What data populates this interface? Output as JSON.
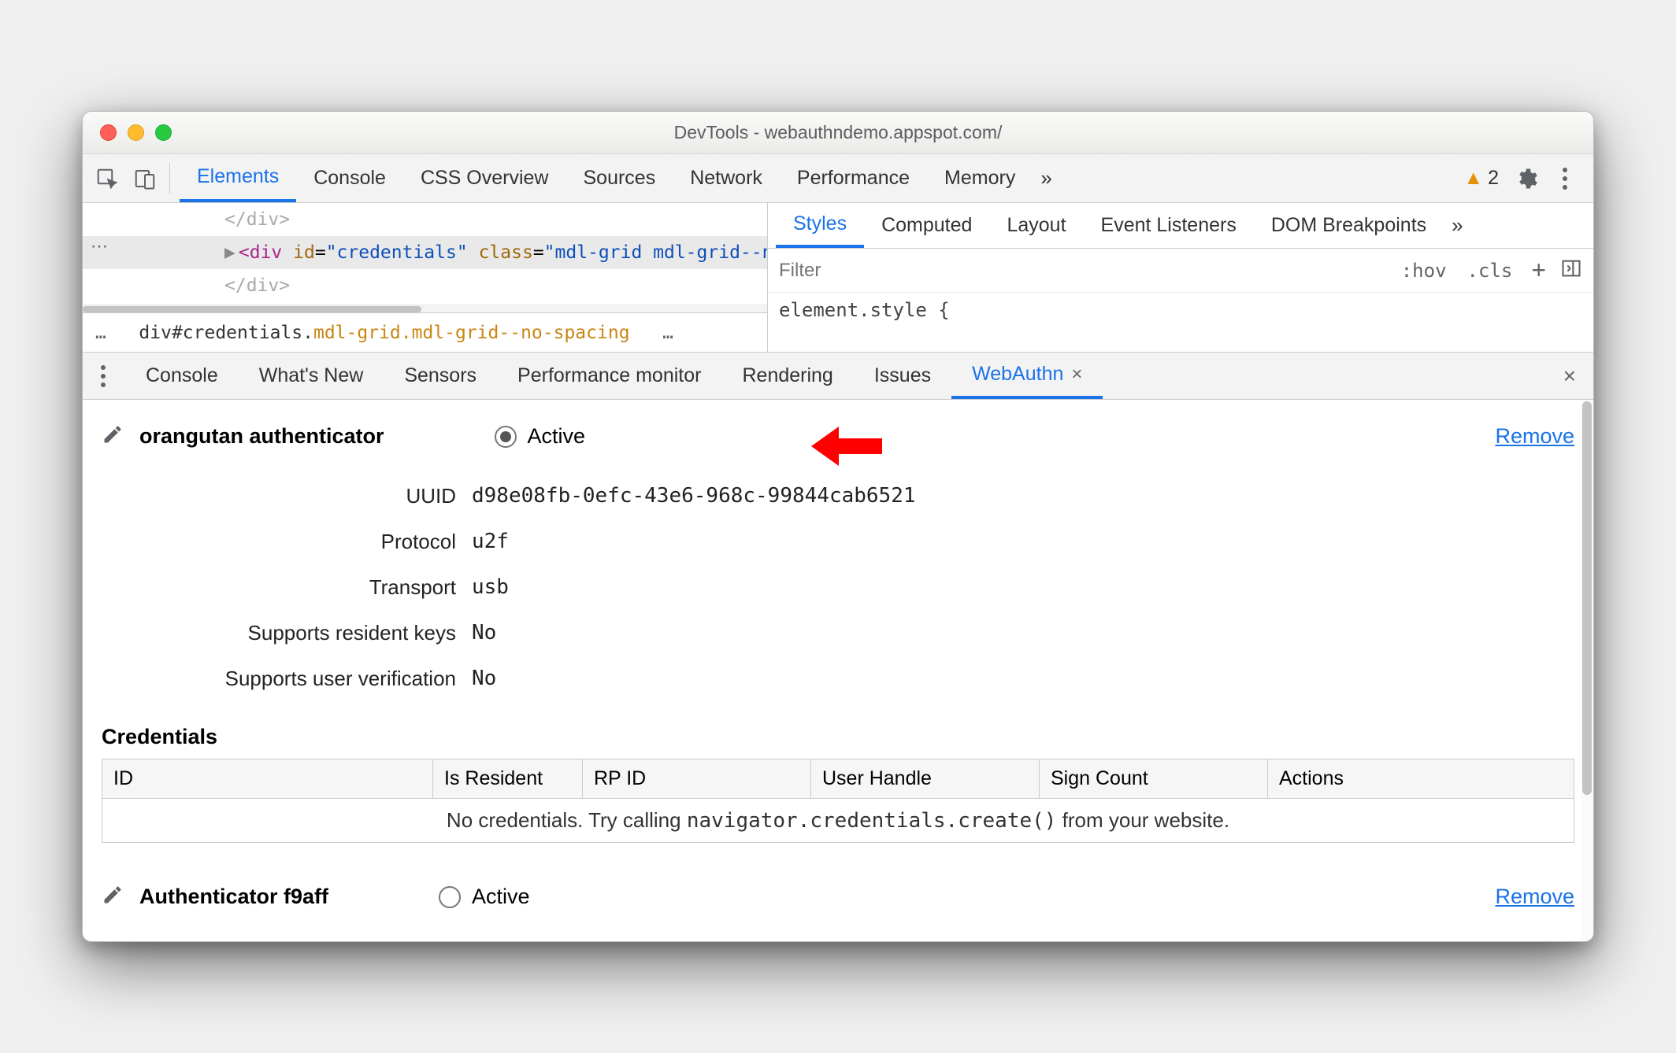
{
  "title": "DevTools - webauthndemo.appspot.com/",
  "main_tabs": [
    "Elements",
    "Console",
    "CSS Overview",
    "Sources",
    "Network",
    "Performance",
    "Memory"
  ],
  "main_active": "Elements",
  "warning_count": "2",
  "elements": {
    "line0": "</div>",
    "line1_open": "<",
    "line1_tag": "div",
    "line1_id_attr": "id",
    "line1_id_val": "\"credentials\"",
    "line1_cls_attr": "class",
    "line1_cls_val": "\"mdl-grid mdl-grid--no-spacing\"",
    "line1_mid": ">…</",
    "line1_close": ">",
    "line2": "</div>",
    "breadcrumb_ellipsis": "…",
    "breadcrumb_a": "div#credentials.",
    "breadcrumb_b": "mdl-grid.mdl-grid--no-spacing",
    "breadcrumb_ellipsis2": "…"
  },
  "styles": {
    "tabs": [
      "Styles",
      "Computed",
      "Layout",
      "Event Listeners",
      "DOM Breakpoints"
    ],
    "active": "Styles",
    "filter_placeholder": "Filter",
    "hov": ":hov",
    "cls": ".cls",
    "rule": "element.style {"
  },
  "drawer": {
    "tabs": [
      "Console",
      "What's New",
      "Sensors",
      "Performance monitor",
      "Rendering",
      "Issues",
      "WebAuthn"
    ],
    "active": "WebAuthn"
  },
  "auth1": {
    "name": "orangutan authenticator",
    "active_label": "Active",
    "remove": "Remove",
    "uuid_label": "UUID",
    "uuid": "d98e08fb-0efc-43e6-968c-99844cab6521",
    "protocol_label": "Protocol",
    "protocol": "u2f",
    "transport_label": "Transport",
    "transport": "usb",
    "resident_label": "Supports resident keys",
    "resident": "No",
    "userver_label": "Supports user verification",
    "userver": "No"
  },
  "credentials": {
    "heading": "Credentials",
    "cols": [
      "ID",
      "Is Resident",
      "RP ID",
      "User Handle",
      "Sign Count",
      "Actions"
    ],
    "empty_pre": "No credentials. Try calling ",
    "empty_code": "navigator.credentials.create()",
    "empty_post": " from your website."
  },
  "auth2": {
    "name": "Authenticator f9aff",
    "active_label": "Active",
    "remove": "Remove"
  }
}
